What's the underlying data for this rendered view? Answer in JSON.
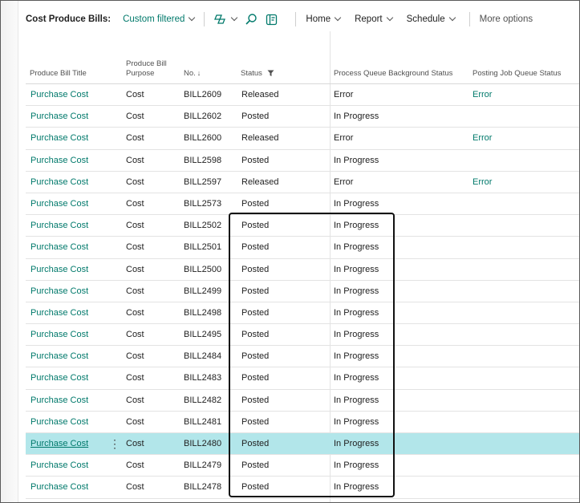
{
  "toolbar": {
    "title": "Cost Produce Bills:",
    "filter_label": "Custom filtered",
    "home_label": "Home",
    "report_label": "Report",
    "schedule_label": "Schedule",
    "more_label": "More options"
  },
  "columns": {
    "title": "Produce Bill Title",
    "purpose_line1": "Produce Bill",
    "purpose_line2": "Purpose",
    "no": "No.",
    "status": "Status",
    "process_queue": "Process Queue Background Status",
    "posting_queue": "Posting Job Queue Status"
  },
  "rows": [
    {
      "title": "Purchase Cost",
      "purpose": "Cost",
      "no": "BILL2609",
      "status": "Released",
      "process_queue": "Error",
      "posting_queue": "Error"
    },
    {
      "title": "Purchase Cost",
      "purpose": "Cost",
      "no": "BILL2602",
      "status": "Posted",
      "process_queue": "In Progress",
      "posting_queue": ""
    },
    {
      "title": "Purchase Cost",
      "purpose": "Cost",
      "no": "BILL2600",
      "status": "Released",
      "process_queue": "Error",
      "posting_queue": "Error"
    },
    {
      "title": "Purchase Cost",
      "purpose": "Cost",
      "no": "BILL2598",
      "status": "Posted",
      "process_queue": "In Progress",
      "posting_queue": ""
    },
    {
      "title": "Purchase Cost",
      "purpose": "Cost",
      "no": "BILL2597",
      "status": "Released",
      "process_queue": "Error",
      "posting_queue": "Error"
    },
    {
      "title": "Purchase Cost",
      "purpose": "Cost",
      "no": "BILL2573",
      "status": "Posted",
      "process_queue": "In Progress",
      "posting_queue": ""
    },
    {
      "title": "Purchase Cost",
      "purpose": "Cost",
      "no": "BILL2502",
      "status": "Posted",
      "process_queue": "In Progress",
      "posting_queue": ""
    },
    {
      "title": "Purchase Cost",
      "purpose": "Cost",
      "no": "BILL2501",
      "status": "Posted",
      "process_queue": "In Progress",
      "posting_queue": ""
    },
    {
      "title": "Purchase Cost",
      "purpose": "Cost",
      "no": "BILL2500",
      "status": "Posted",
      "process_queue": "In Progress",
      "posting_queue": ""
    },
    {
      "title": "Purchase Cost",
      "purpose": "Cost",
      "no": "BILL2499",
      "status": "Posted",
      "process_queue": "In Progress",
      "posting_queue": ""
    },
    {
      "title": "Purchase Cost",
      "purpose": "Cost",
      "no": "BILL2498",
      "status": "Posted",
      "process_queue": "In Progress",
      "posting_queue": ""
    },
    {
      "title": "Purchase Cost",
      "purpose": "Cost",
      "no": "BILL2495",
      "status": "Posted",
      "process_queue": "In Progress",
      "posting_queue": ""
    },
    {
      "title": "Purchase Cost",
      "purpose": "Cost",
      "no": "BILL2484",
      "status": "Posted",
      "process_queue": "In Progress",
      "posting_queue": ""
    },
    {
      "title": "Purchase Cost",
      "purpose": "Cost",
      "no": "BILL2483",
      "status": "Posted",
      "process_queue": "In Progress",
      "posting_queue": ""
    },
    {
      "title": "Purchase Cost",
      "purpose": "Cost",
      "no": "BILL2482",
      "status": "Posted",
      "process_queue": "In Progress",
      "posting_queue": ""
    },
    {
      "title": "Purchase Cost",
      "purpose": "Cost",
      "no": "BILL2481",
      "status": "Posted",
      "process_queue": "In Progress",
      "posting_queue": ""
    },
    {
      "title": "Purchase Cost",
      "purpose": "Cost",
      "no": "BILL2480",
      "status": "Posted",
      "process_queue": "In Progress",
      "posting_queue": "",
      "selected": true
    },
    {
      "title": "Purchase Cost",
      "purpose": "Cost",
      "no": "BILL2479",
      "status": "Posted",
      "process_queue": "In Progress",
      "posting_queue": ""
    },
    {
      "title": "Purchase Cost",
      "purpose": "Cost",
      "no": "BILL2478",
      "status": "Posted",
      "process_queue": "In Progress",
      "posting_queue": ""
    }
  ],
  "icons": {
    "copilot": "copilot-icon",
    "search": "search-icon",
    "filter_pane": "filter-pane-icon",
    "sort": "sort-descending-icon",
    "column_filter": "funnel-icon"
  },
  "colors": {
    "accent": "#00796b",
    "selected_row": "#b2e6ea"
  }
}
